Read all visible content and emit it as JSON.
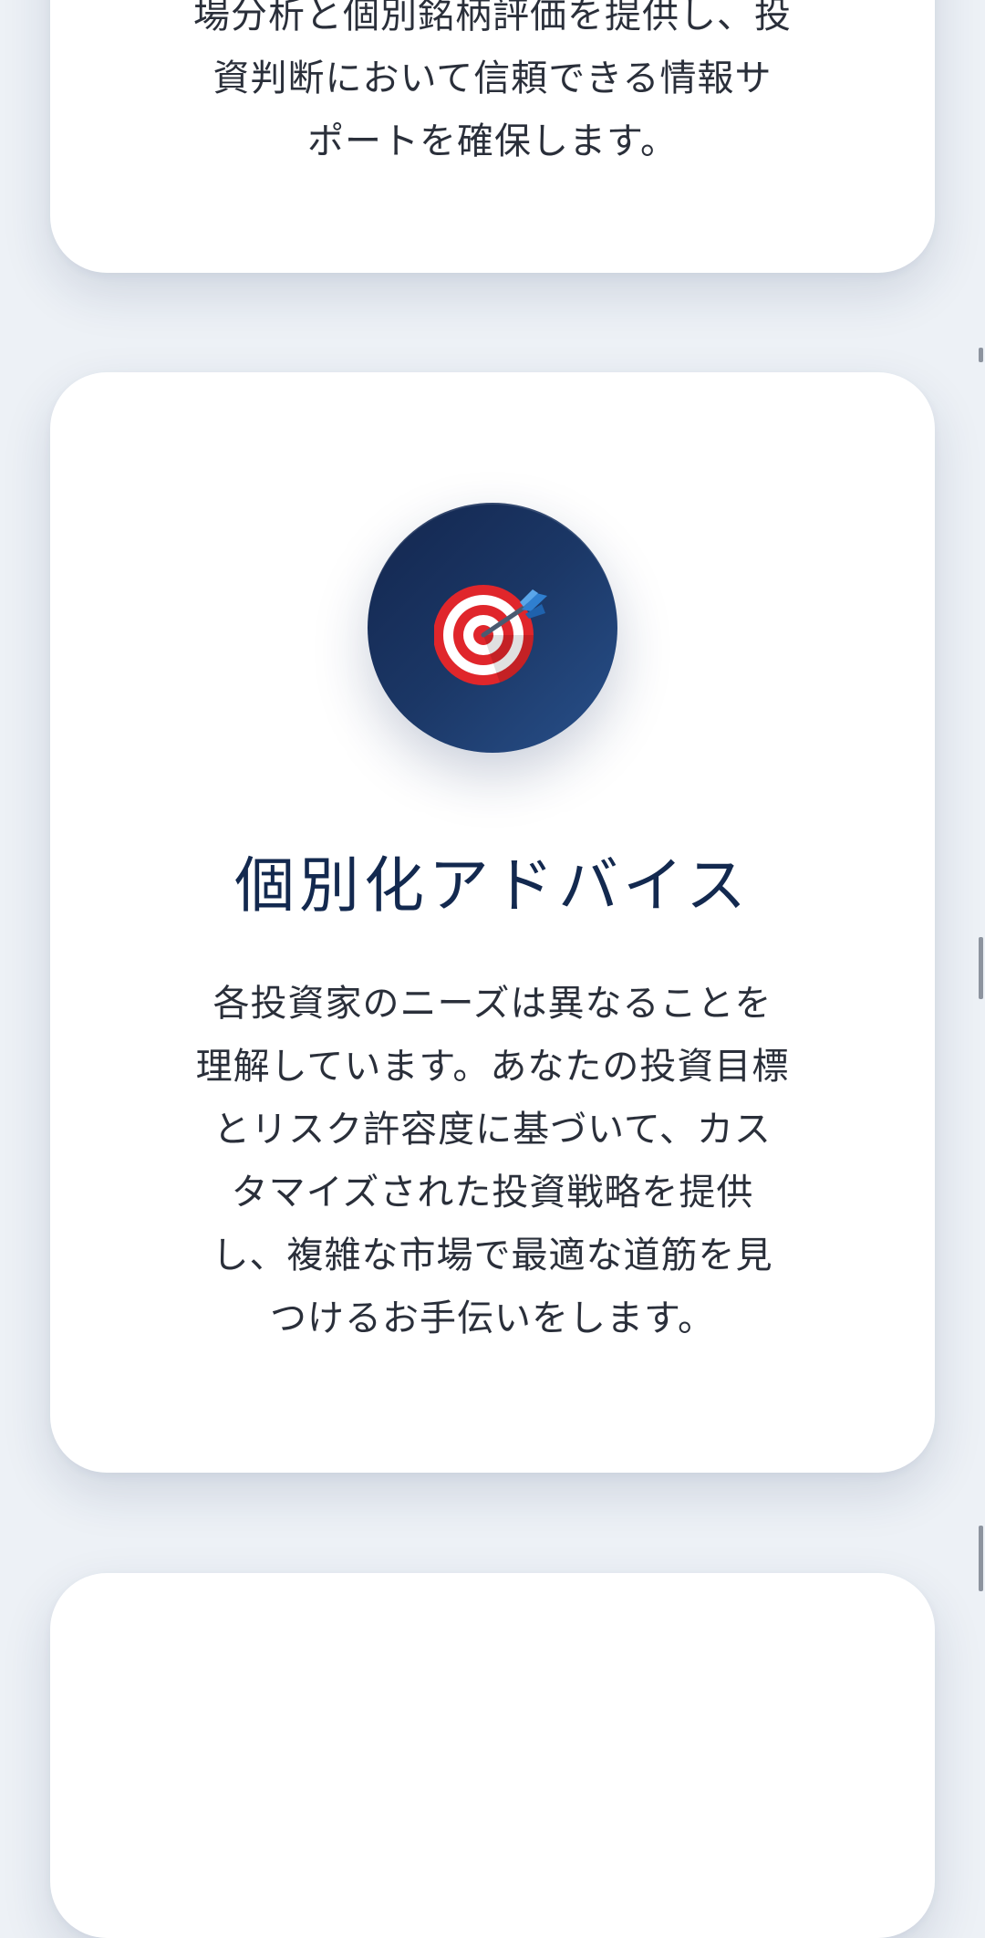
{
  "cards": {
    "previous": {
      "description_lines": [
        "場分析と個別銘柄評価を提供し、投",
        "資判断において信頼できる情報サ",
        "ポートを確保します。"
      ]
    },
    "main": {
      "icon": "target-dart-icon",
      "title": "個別化アドバイス",
      "description_lines": [
        "各投資家のニーズは異なることを",
        "理解しています。あなたの投資目標",
        "とリスク許容度に基づいて、カス",
        "タマイズされた投資戦略を提供",
        "し、複雑な市場で最適な道筋を見",
        "つけるお手伝いをします。"
      ]
    }
  },
  "colors": {
    "page_background": "#edf1f6",
    "card_background": "#ffffff",
    "title": "#13294f",
    "body_text": "#2a2f3a",
    "icon_circle_dark": "#13264e",
    "icon_circle_light": "#28508a"
  }
}
